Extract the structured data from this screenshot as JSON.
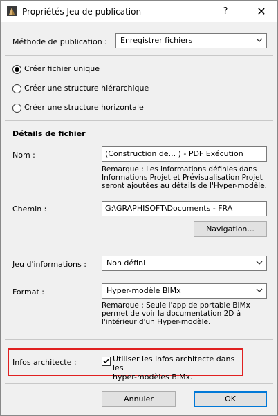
{
  "window": {
    "title": "Propriétés Jeu de publication",
    "help_label": "?",
    "close_label": "✕"
  },
  "publish": {
    "label": "Méthode de publication :",
    "value": "Enregistrer fichiers"
  },
  "radios": [
    {
      "label": "Créer fichier unique",
      "selected": true
    },
    {
      "label": "Créer une structure hiérarchique",
      "selected": false
    },
    {
      "label": "Créer une structure horizontale",
      "selected": false
    }
  ],
  "details": {
    "heading": "Détails de fichier",
    "name_label": "Nom :",
    "name_value": "(Construction de... ) - PDF Exécution",
    "name_note": [
      "Remarque : Les informations définies dans",
      "Informations Projet et Prévisualisation Projet",
      "seront ajoutées au détails de l'Hyper-modèle."
    ],
    "path_label": "Chemin :",
    "path_value": "G:\\GRAPHISOFT\\Documents - FRA",
    "navigation_label": "Navigation..."
  },
  "infoset": {
    "label": "Jeu d'informations :",
    "value": "Non défini"
  },
  "format": {
    "label": "Format :",
    "value": "Hyper-modèle BIMx",
    "note": [
      "Remarque : Seule l'app de portable BIMx",
      "permet de voir la documentation 2D à",
      "l'intérieur d'un Hyper-modèle."
    ]
  },
  "architect": {
    "label": "Infos architecte :",
    "checkbox_line1": "Utiliser les infos architecte dans les",
    "checkbox_line2": "hyper-modèles BIMx.",
    "checked": true
  },
  "footer": {
    "cancel_label": "Annuler",
    "ok_label": "OK"
  },
  "colors": {
    "highlight": "#e02020",
    "ok_border": "#0078d7"
  }
}
